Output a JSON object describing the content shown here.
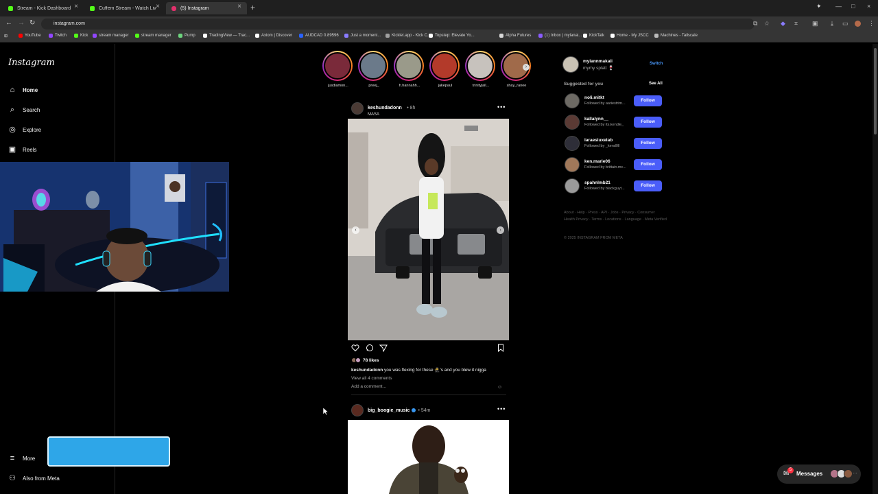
{
  "browser": {
    "tabs": [
      {
        "title": "Stream - Kick Dashboard",
        "color": "#53fc18"
      },
      {
        "title": "Cuffem Stream - Watch Live on",
        "color": "#53fc18"
      },
      {
        "title": "(5) Instagram",
        "color": "#e1306c"
      }
    ],
    "url": "instagram.com",
    "bookmarks": [
      {
        "label": "YouTube",
        "color": "#ff0000"
      },
      {
        "label": "Twitch",
        "color": "#9146ff"
      },
      {
        "label": "Kick",
        "color": "#53fc18"
      },
      {
        "label": "stream manager",
        "color": "#9146ff"
      },
      {
        "label": "stream manager",
        "color": "#53fc18"
      },
      {
        "label": "Pump",
        "color": "#6dd47e"
      },
      {
        "label": "TradingView — Trac...",
        "color": "#ffffff"
      },
      {
        "label": "Axiom | Discover",
        "color": "#ffffff"
      },
      {
        "label": "AUDCAD 0.89596",
        "color": "#2962ff"
      },
      {
        "label": "Just a moment...",
        "color": "#8a7cff"
      },
      {
        "label": "Kicklet.app - Kick C...",
        "color": "#a0a0a0"
      },
      {
        "label": "Topstep: Elevate Yo...",
        "color": "#ffffff"
      },
      {
        "label": "Alpha Futures",
        "color": "#d6d6d6"
      },
      {
        "label": "(1) Inbox | mylanai...",
        "color": "#8a5cff"
      },
      {
        "label": "KickTalk",
        "color": "#ffffff"
      },
      {
        "label": "Home - My JSCC",
        "color": "#ffffff"
      },
      {
        "label": "Machines - Tailscale",
        "color": "#bbbbbb"
      }
    ]
  },
  "sidebar": {
    "logo": "Instagram",
    "items": [
      {
        "label": "Home",
        "icon": "home-icon"
      },
      {
        "label": "Search",
        "icon": "search-icon"
      },
      {
        "label": "Explore",
        "icon": "explore-icon"
      },
      {
        "label": "Reels",
        "icon": "reels-icon"
      }
    ],
    "more": "More",
    "also_from_meta": "Also from Meta"
  },
  "stories": [
    {
      "name": "jusdiamon...",
      "color": "#7a2a3a"
    },
    {
      "name": "preej_",
      "color": "#6b7a8a"
    },
    {
      "name": "h.hannahh...",
      "color": "#9a9a8a"
    },
    {
      "name": "jakepaul",
      "color": "#b33a2a"
    },
    {
      "name": "trinityjail...",
      "color": "#c7c2bd"
    },
    {
      "name": "shay_ranee",
      "color": "#a06a4a"
    }
  ],
  "posts": [
    {
      "username": "keshundadonn",
      "time": "8h",
      "location": "MASA",
      "likes": "78 likes",
      "caption_user": "keshundadonn",
      "caption_text": "you was flexing for these 🥷's and you blew it nigga",
      "view_all": "View all 4 comments",
      "add_comment": "Add a comment..."
    },
    {
      "username": "big_boogie_music",
      "time": "54m"
    }
  ],
  "right_panel": {
    "me": {
      "username": "mylannmakaii",
      "display": "mymy splatt 🍷"
    },
    "switch": "Switch",
    "suggested_header": "Suggested for you",
    "see_all": "See All",
    "suggestions": [
      {
        "name": "noli.mitkt",
        "followed_by": "Followed by aariestrim...",
        "color": "#6d6a64"
      },
      {
        "name": "kallalynn__",
        "followed_by": "Followed by its.kendle_",
        "color": "#5a3a34"
      },
      {
        "name": "laraesluxelab",
        "followed_by": "Followed by _kend0ll",
        "color": "#2e2e38"
      },
      {
        "name": "ken.marie06",
        "followed_by": "Followed by brittain.mc...",
        "color": "#a0785a"
      },
      {
        "name": "spahnlmb21",
        "followed_by": "Followed by blackguyt...",
        "color": "#9a9a9a"
      }
    ],
    "follow_label": "Follow",
    "footer_links": "About · Help · Press · API · Jobs · Privacy · Consumer Health Privacy · Terms · Locations · Language · Meta Verified",
    "copyright": "© 2025 INSTAGRAM FROM META"
  },
  "messages": {
    "label": "Messages",
    "badge": "5"
  }
}
